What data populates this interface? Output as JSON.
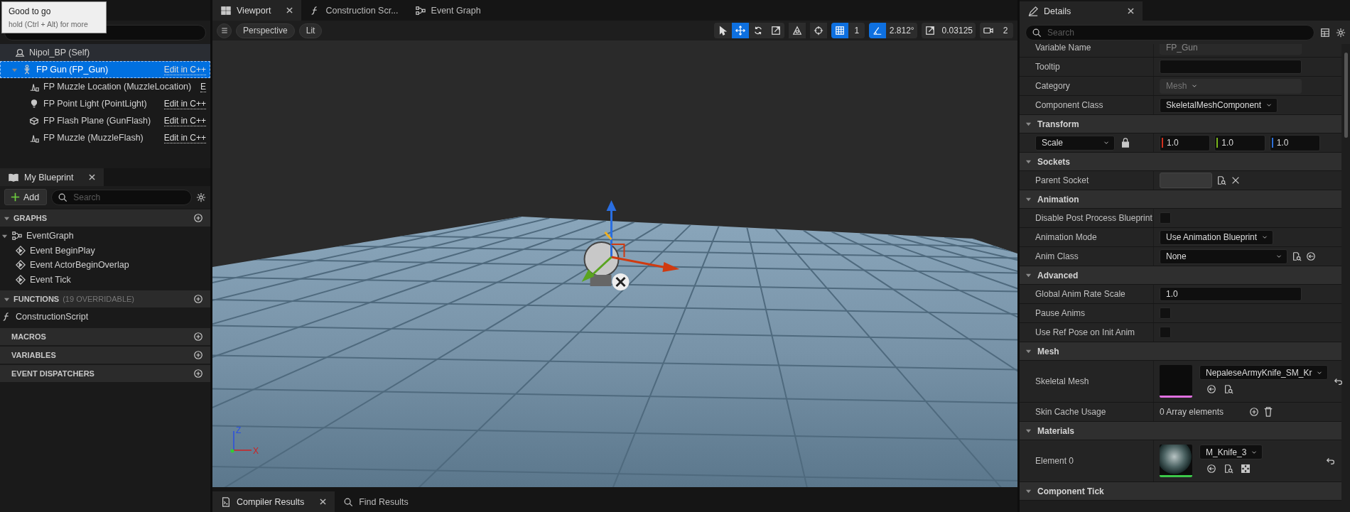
{
  "tooltip": {
    "title": "Good to go",
    "hint": "hold (Ctrl + Alt) for more"
  },
  "components": {
    "items": [
      {
        "label": "Nipol_BP (Self)",
        "kind": "actor",
        "selected": false,
        "children": [
          {
            "label": "FP Gun (FP_Gun)",
            "kind": "skeletal_mesh",
            "action": "Edit in C++",
            "selected": true,
            "expanded": true,
            "children": [
              {
                "label": "FP Muzzle Location (MuzzleLocation)",
                "kind": "arrow",
                "action": "E",
                "selected": false
              },
              {
                "label": "FP Point Light (PointLight)",
                "kind": "point_light",
                "action": "Edit in C++",
                "selected": false
              },
              {
                "label": "FP Flash Plane (GunFlash)",
                "kind": "static_mesh",
                "action": "Edit in C++",
                "selected": false
              },
              {
                "label": "FP Muzzle (MuzzleFlash)",
                "kind": "arrow",
                "action": "Edit in C++",
                "selected": false
              }
            ]
          }
        ]
      }
    ]
  },
  "my_blueprint": {
    "tab": "My Blueprint",
    "add": "Add",
    "search": {
      "placeholder": "Search"
    },
    "sections": [
      {
        "title": "GRAPHS",
        "expanded": true,
        "items": [
          {
            "label": "EventGraph",
            "kind": "graph",
            "expanded": true,
            "children": [
              {
                "label": "Event BeginPlay",
                "kind": "event"
              },
              {
                "label": "Event ActorBeginOverlap",
                "kind": "event"
              },
              {
                "label": "Event Tick",
                "kind": "event"
              }
            ]
          }
        ]
      },
      {
        "title": "FUNCTIONS",
        "note": "(19 OVERRIDABLE)",
        "expanded": true,
        "items": [
          {
            "label": "ConstructionScript",
            "kind": "function"
          }
        ]
      },
      {
        "title": "MACROS"
      },
      {
        "title": "VARIABLES"
      },
      {
        "title": "EVENT DISPATCHERS"
      }
    ]
  },
  "editor_tabs": [
    {
      "label": "Viewport",
      "kind": "viewport",
      "selected": true,
      "closable": true
    },
    {
      "label": "Construction Scr...",
      "kind": "function",
      "selected": false
    },
    {
      "label": "Event Graph",
      "kind": "graph",
      "selected": false
    }
  ],
  "viewport": {
    "view_mode": "Perspective",
    "lighting": "Lit",
    "tools": [
      {
        "kind": "select",
        "selected": false
      },
      {
        "kind": "translate",
        "selected": true
      },
      {
        "kind": "rotate",
        "selected": false
      },
      {
        "kind": "scale",
        "selected": false
      }
    ],
    "snaps": [
      {
        "kind": "grid",
        "value": "1",
        "on": true
      },
      {
        "kind": "angle",
        "value": "2.812°",
        "on": true
      },
      {
        "kind": "scale",
        "value": "0.03125",
        "on": false
      },
      {
        "kind": "camera",
        "value": "2",
        "on": false
      }
    ],
    "axes": [
      "Z",
      "X"
    ]
  },
  "bottom_tabs": [
    {
      "label": "Compiler Results",
      "kind": "log",
      "selected": true,
      "closable": true
    },
    {
      "label": "Find Results",
      "kind": "search",
      "selected": false
    }
  ],
  "details": {
    "tab": "Details",
    "search": {
      "placeholder": "Search"
    },
    "rows": [
      {
        "kind": "text",
        "label": "Variable Name",
        "value": "FP_Gun",
        "disabled": true
      },
      {
        "kind": "text",
        "label": "Tooltip"
      },
      {
        "kind": "dropdown",
        "label": "Category",
        "value": "Mesh",
        "disabled": true
      },
      {
        "kind": "dropdown",
        "label": "Component Class",
        "value": "SkeletalMeshComponent"
      },
      {
        "kind": "section",
        "label": "Transform",
        "expanded": true
      },
      {
        "kind": "vector",
        "label": "Scale",
        "locked": true,
        "values": [
          "1.0",
          "1.0",
          "1.0"
        ]
      },
      {
        "kind": "section",
        "label": "Sockets",
        "expanded": true
      },
      {
        "kind": "socket",
        "label": "Parent Socket"
      },
      {
        "kind": "section",
        "label": "Animation",
        "expanded": true
      },
      {
        "kind": "checkbox",
        "label": "Disable Post Process Blueprint",
        "checked": false
      },
      {
        "kind": "dropdown",
        "label": "Animation Mode",
        "value": "Use Animation Blueprint"
      },
      {
        "kind": "class",
        "label": "Anim Class",
        "value": "None"
      },
      {
        "kind": "section",
        "label": "Advanced",
        "expanded": true
      },
      {
        "kind": "text",
        "label": "Global Anim Rate Scale",
        "value": "1.0"
      },
      {
        "kind": "checkbox",
        "label": "Pause Anims",
        "checked": false
      },
      {
        "kind": "checkbox",
        "label": "Use Ref Pose on Init Anim",
        "checked": false
      },
      {
        "kind": "section",
        "label": "Mesh",
        "expanded": true
      },
      {
        "kind": "asset",
        "label": "Skeletal Mesh",
        "value": "NepaleseArmyKnife_SM_Kr",
        "thumbnail": {
          "kind": "mesh",
          "color": "#e070e0"
        }
      },
      {
        "kind": "array",
        "label": "Skin Cache Usage",
        "value": "0 Array elements"
      },
      {
        "kind": "section",
        "label": "Materials",
        "expanded": true
      },
      {
        "kind": "asset",
        "label": "Element 0",
        "value": "M_Knife_3",
        "thumbnail": {
          "kind": "material",
          "color": "#3cc84a"
        }
      },
      {
        "kind": "section",
        "label": "Component Tick",
        "expanded": true
      }
    ]
  }
}
